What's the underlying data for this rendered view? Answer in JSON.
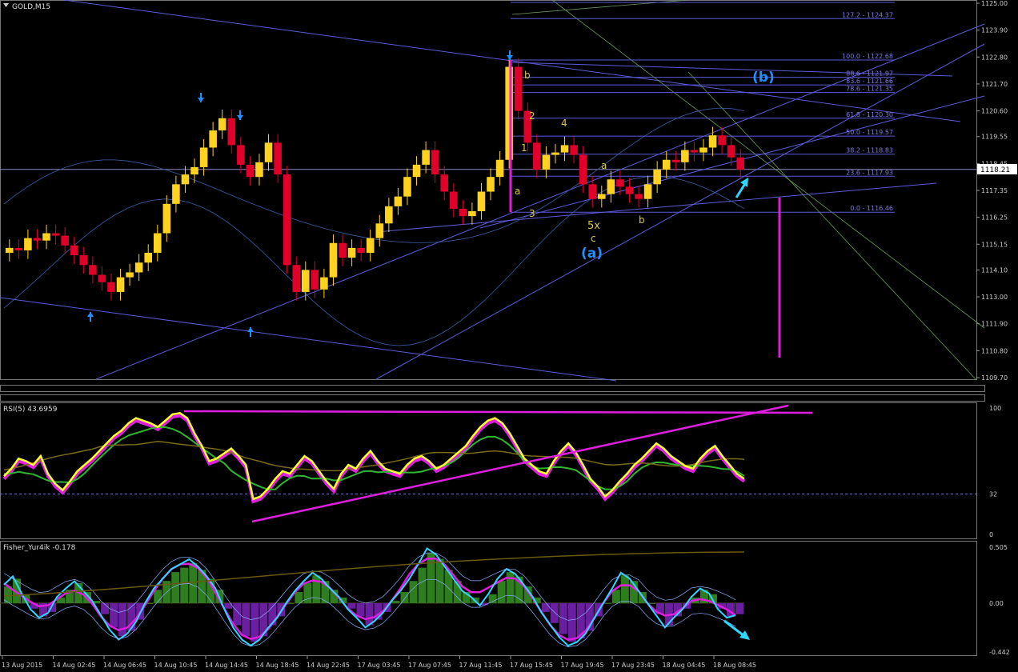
{
  "main": {
    "title": "GOLD,M15",
    "price_label": "1118.21",
    "y_ticks": [
      "1125.00",
      "1123.90",
      "1122.80",
      "1121.70",
      "1120.60",
      "1119.55",
      "1118.45",
      "1117.35",
      "1116.25",
      "1115.15",
      "1114.10",
      "1113.00",
      "1111.90",
      "1110.80",
      "1109.70"
    ],
    "fib_levels": [
      "127.2 - 1124.37",
      "100.0 - 1122.68",
      "88.6 - 1121.97",
      "83.6 - 1121.66",
      "78.6 - 1121.35",
      "61.8 - 1120.30",
      "50.0 - 1119.57",
      "38.2 - 1118.83",
      "23.6 - 1117.93",
      "0.0 - 1116.46"
    ],
    "wave_labels": {
      "b_small": "b",
      "two": "2",
      "four": "4",
      "one": "1",
      "a_small": "a",
      "three": "3",
      "a_small2": "a",
      "five_x": "5x",
      "c": "c",
      "b_small2": "b",
      "a_big": "(a)",
      "b_big": "(b)"
    }
  },
  "rsi": {
    "title": "RSI(5) 43.6959",
    "y_ticks": [
      "100",
      "32",
      "0"
    ]
  },
  "fisher": {
    "title": "Fisher_Yur4ik -0.178",
    "y_ticks": [
      "0.505",
      "0.00",
      "-0.442"
    ]
  },
  "x_axis": [
    "13 Aug 2015",
    "14 Aug 02:45",
    "14 Aug 06:45",
    "14 Aug 10:45",
    "14 Aug 14:45",
    "14 Aug 18:45",
    "14 Aug 22:45",
    "17 Aug 03:45",
    "17 Aug 07:45",
    "17 Aug 11:45",
    "17 Aug 15:45",
    "17 Aug 19:45",
    "17 Aug 23:45",
    "18 Aug 04:45",
    "18 Aug 08:45"
  ],
  "colors": {
    "up": "#ffd21f",
    "down": "#e0002a",
    "lines": "#5b5bd9",
    "magenta": "#e01ee0",
    "cyan": "#2fd6ff",
    "wave_blue": "#1e90ff",
    "axis": "#9a9a9a"
  },
  "chart_data": [
    {
      "type": "candlestick",
      "title": "GOLD,M15",
      "ylim": [
        1109.7,
        1125.0
      ],
      "close_values": [
        1115.0,
        1114.9,
        1115.4,
        1115.3,
        1115.6,
        1115.5,
        1115.1,
        1114.7,
        1114.3,
        1113.9,
        1113.6,
        1113.2,
        1113.8,
        1114.0,
        1114.4,
        1114.8,
        1115.6,
        1116.8,
        1117.6,
        1118.0,
        1118.3,
        1119.1,
        1119.8,
        1120.3,
        1119.2,
        1118.4,
        1117.9,
        1118.5,
        1119.3,
        1118.0,
        1114.3,
        1113.2,
        1114.1,
        1113.3,
        1113.8,
        1115.2,
        1114.6,
        1115.0,
        1114.8,
        1115.4,
        1116.0,
        1116.7,
        1117.1,
        1117.9,
        1118.4,
        1119.0,
        1118.0,
        1117.3,
        1116.6,
        1116.3,
        1116.5,
        1117.3,
        1117.9,
        1118.6,
        1122.4,
        1120.6,
        1119.3,
        1118.2,
        1118.8,
        1118.9,
        1119.2,
        1118.8,
        1117.6,
        1117.0,
        1117.2,
        1117.8,
        1117.5,
        1117.2,
        1117.0,
        1117.6,
        1118.2,
        1118.6,
        1118.5,
        1119.0,
        1118.9,
        1119.1,
        1119.6,
        1119.2,
        1118.7,
        1118.2
      ],
      "x_labels": [
        "13 Aug 2015",
        "14 Aug 02:45",
        "14 Aug 06:45",
        "14 Aug 10:45",
        "14 Aug 14:45",
        "14 Aug 18:45",
        "14 Aug 22:45",
        "17 Aug 03:45",
        "17 Aug 07:45",
        "17 Aug 11:45",
        "17 Aug 15:45",
        "17 Aug 19:45",
        "17 Aug 23:45",
        "18 Aug 04:45",
        "18 Aug 08:45"
      ],
      "fibonacci": [
        {
          "level": 127.2,
          "price": 1124.37
        },
        {
          "level": 100.0,
          "price": 1122.68
        },
        {
          "level": 88.6,
          "price": 1121.97
        },
        {
          "level": 83.6,
          "price": 1121.66
        },
        {
          "level": 78.6,
          "price": 1121.35
        },
        {
          "level": 61.8,
          "price": 1120.3
        },
        {
          "level": 50.0,
          "price": 1119.57
        },
        {
          "level": 38.2,
          "price": 1118.83
        },
        {
          "level": 23.6,
          "price": 1117.93
        },
        {
          "level": 0.0,
          "price": 1116.46
        }
      ],
      "current_price": 1118.21
    },
    {
      "type": "line",
      "title": "RSI(5) 43.6959",
      "ylim": [
        0,
        100
      ],
      "levels": [
        32
      ],
      "series": [
        {
          "values": [
            46,
            52,
            60,
            58,
            55,
            62,
            48,
            40,
            35,
            42,
            50,
            55,
            60,
            66,
            72,
            78,
            82,
            88,
            92,
            90,
            88,
            85,
            90,
            95,
            96,
            92,
            80,
            70,
            58,
            60,
            64,
            68,
            62,
            55,
            28,
            30,
            36,
            44,
            50,
            48,
            55,
            62,
            58,
            50,
            42,
            36,
            48,
            55,
            52,
            60,
            66,
            58,
            52,
            50,
            48,
            55,
            60,
            62,
            58,
            52,
            55,
            60,
            65,
            70,
            78,
            85,
            90,
            92,
            88,
            80,
            70,
            60,
            55,
            50,
            48,
            58,
            66,
            72,
            65,
            55,
            44,
            38,
            30,
            35,
            42,
            48,
            55,
            60,
            66,
            72,
            68,
            62,
            58,
            54,
            52,
            60,
            66,
            70,
            62,
            55,
            48,
            44
          ]
        }
      ]
    },
    {
      "type": "bar",
      "title": "Fisher_Yur4ik -0.178",
      "ylim": [
        -0.442,
        0.505
      ],
      "values": [
        0.15,
        0.22,
        0.08,
        -0.05,
        -0.12,
        -0.08,
        0.05,
        0.12,
        0.18,
        0.1,
        0.02,
        -0.1,
        -0.22,
        -0.3,
        -0.25,
        -0.15,
        0.0,
        0.12,
        0.2,
        0.28,
        0.32,
        0.36,
        0.3,
        0.22,
        0.12,
        -0.05,
        -0.2,
        -0.3,
        -0.35,
        -0.3,
        -0.2,
        -0.12,
        0.0,
        0.1,
        0.18,
        0.25,
        0.2,
        0.12,
        0.05,
        -0.05,
        -0.12,
        -0.2,
        -0.15,
        -0.08,
        0.02,
        0.1,
        0.2,
        0.32,
        0.45,
        0.4,
        0.3,
        0.2,
        0.1,
        0.05,
        -0.02,
        0.08,
        0.2,
        0.28,
        0.24,
        0.15,
        0.05,
        -0.08,
        -0.18,
        -0.28,
        -0.35,
        -0.32,
        -0.25,
        -0.12,
        0.0,
        0.12,
        0.25,
        0.2,
        0.1,
        0.0,
        -0.1,
        -0.2,
        -0.12,
        -0.05,
        0.05,
        0.12,
        0.08,
        -0.05,
        -0.12,
        -0.1
      ]
    }
  ]
}
